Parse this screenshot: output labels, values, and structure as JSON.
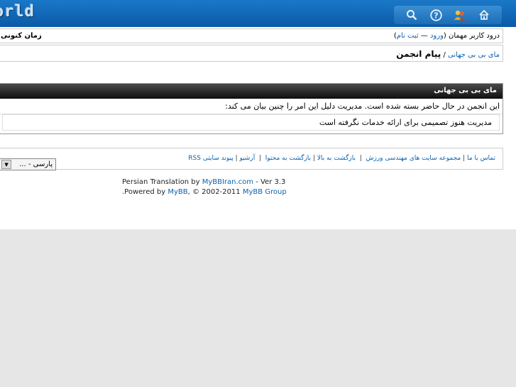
{
  "header": {
    "logo_text": "orld",
    "icons": [
      "search-icon",
      "help-icon",
      "members-icon",
      "home-icon"
    ]
  },
  "userbar": {
    "welcome_prefix": "درود کاربر مهمان (",
    "login": "ورود",
    "sep": " — ",
    "register": "ثبت نام",
    "welcome_suffix": ")",
    "time_label": "زمان کنونی"
  },
  "nav": {
    "home": "مای بی بی جهانی",
    "sep": " / ",
    "current": "پیام انجمن"
  },
  "message": {
    "title": "مای بی بی جهانی",
    "line1": "این انجمن در حال حاضر بسته شده است. مدیریت دلیل این امر را چنین بیان می کند:",
    "line2": "مدیریت هنوز تصمیمی برای ارائه خدمات نگرفته است"
  },
  "footer": {
    "contact": "تماس با ما",
    "engineering": "مجموعه سایت های مهندسی ورزش",
    "top": "بازگشت به بالا",
    "content": "بازگشت به محتوا",
    "archive": "آرشیو",
    "rss": "پیوند سایتی RSS",
    "language_selected": "پارسی - ..."
  },
  "credits": {
    "translation_prefix": "Persian Translation by ",
    "translation_link": "MyBBIran.com",
    "translation_suffix": " - Ver 3.3",
    "powered_prefix": ".Powered by ",
    "powered_link": "MyBB",
    "powered_mid": ", © 2002-2011 ",
    "powered_group": "MyBB Group"
  }
}
